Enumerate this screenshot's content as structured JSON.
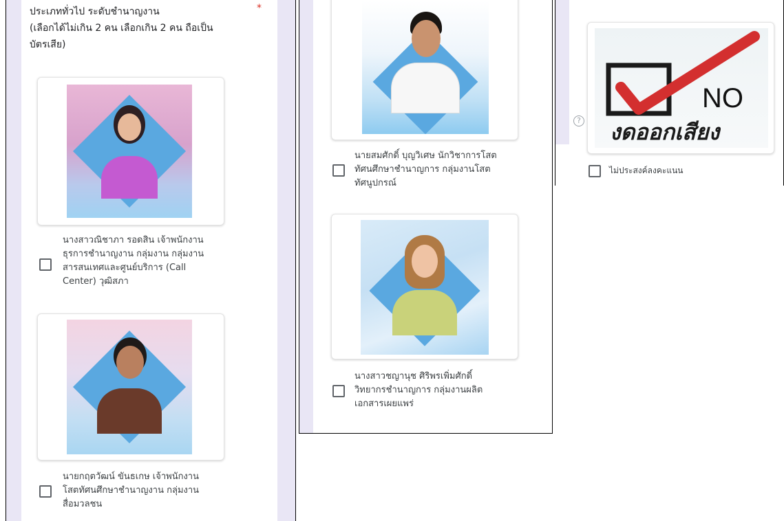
{
  "question": {
    "title_lines": [
      "ประเภททั่วไป ระดับชำนาญงาน",
      "(เลือกได้ไม่เกิน 2 คน เลือกเกิน 2 คน ถือเป็น",
      "บัตรเสีย)"
    ],
    "required_mark": "*"
  },
  "candidates": [
    {
      "label_lines": [
        "นางสาวณิชาภา รอดสิน เจ้าพนักงาน",
        "ธุรการชำนาญงาน กลุ่มงาน กลุ่มงาน",
        "สารสนเทศและศูนย์บริการ (Call",
        "Center) วุฒิสภา"
      ],
      "checked": false
    },
    {
      "label_lines": [
        "นายกฤตวัฒน์ ขันธเกษ เจ้าพนักงาน",
        "โสตทัศนศึกษาชำนาญงาน กลุ่มงาน",
        "สื่อมวลชน"
      ],
      "checked": false
    },
    {
      "label_lines": [
        "นายสมศักดิ์ บุญวิเศษ นักวิชาการโสต",
        "ทัศนศึกษาชำนาญการ กลุ่มงานโสต",
        "ทัศนูปกรณ์"
      ],
      "checked": false
    },
    {
      "label_lines": [
        "นางสาวชญานุช ศิริพรเพิ่มศักดิ์",
        "วิทยากรชำนาญการ กลุ่มงานผลิต",
        "เอกสารเผยแพร่"
      ],
      "checked": false
    }
  ],
  "abstain": {
    "no_text": "NO",
    "thai_text": "งดออกเสียง",
    "help_glyph": "?",
    "label": "ไม่ประสงค์ลงคะแนน",
    "checked": false
  },
  "colors": {
    "stripe": "#e9e6f5",
    "diamond_blue": "#5aa8e0",
    "check_red": "#d32f2f",
    "required_red": "#d93025"
  }
}
